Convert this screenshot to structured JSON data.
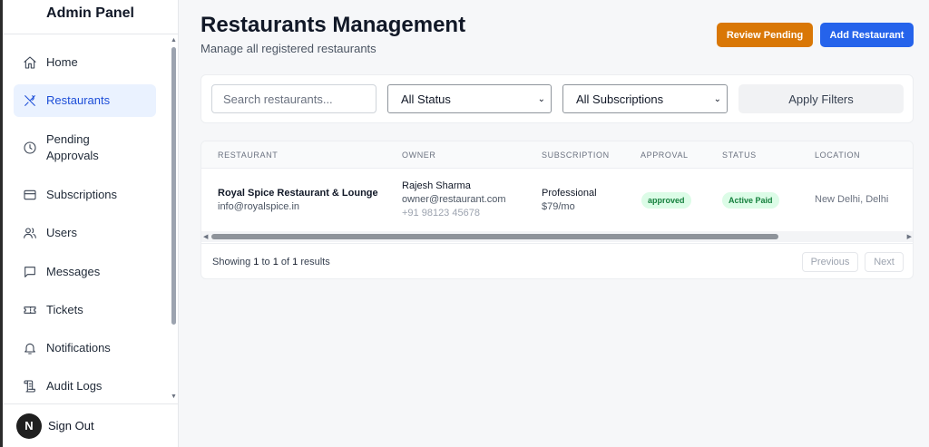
{
  "sidebar": {
    "title": "Admin Panel",
    "items": [
      {
        "label": "Home",
        "icon": "home-icon"
      },
      {
        "label": "Restaurants",
        "icon": "utensils-icon",
        "active": true
      },
      {
        "label": "Pending Approvals",
        "label_line1": "Pending",
        "label_line2": "Approvals",
        "icon": "clock-icon"
      },
      {
        "label": "Subscriptions",
        "icon": "credit-card-icon"
      },
      {
        "label": "Users",
        "icon": "users-icon"
      },
      {
        "label": "Messages",
        "icon": "message-icon"
      },
      {
        "label": "Tickets",
        "icon": "ticket-icon"
      },
      {
        "label": "Notifications",
        "icon": "bell-icon"
      },
      {
        "label": "Audit Logs",
        "icon": "scroll-icon"
      }
    ],
    "footer": {
      "avatar_letter": "N",
      "signout_label": "Sign Out"
    }
  },
  "header": {
    "title": "Restaurants Management",
    "subtitle": "Manage all registered restaurants",
    "review_label": "Review Pending",
    "add_label": "Add Restaurant"
  },
  "filters": {
    "search_placeholder": "Search restaurants...",
    "status_value": "All Status",
    "subscription_value": "All Subscriptions",
    "apply_label": "Apply Filters"
  },
  "table": {
    "columns": [
      "RESTAURANT",
      "OWNER",
      "SUBSCRIPTION",
      "APPROVAL",
      "STATUS",
      "LOCATION"
    ],
    "rows": [
      {
        "name": "Royal Spice Restaurant & Lounge",
        "email": "info@royalspice.in",
        "owner_name": "Rajesh Sharma",
        "owner_email": "owner@restaurant.com",
        "owner_phone": "+91 98123 45678",
        "plan": "Professional",
        "price": "$79/mo",
        "approval": "approved",
        "status": "Active Paid",
        "location": "New Delhi, Delhi"
      }
    ]
  },
  "pagination": {
    "showing_prefix": "Showing",
    "from": "1",
    "to_word": "to",
    "to": "1",
    "of_word": "of",
    "total": "1",
    "suffix": "results",
    "prev_label": "Previous",
    "next_label": "Next"
  },
  "colors": {
    "accent_blue": "#2563eb",
    "review_orange": "#d97706",
    "badge_green_bg": "#dcfce7",
    "badge_green_text": "#15803d"
  }
}
